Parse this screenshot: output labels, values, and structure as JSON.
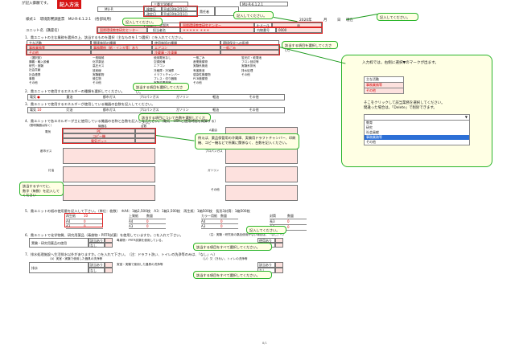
{
  "header": {
    "note_left": "が記入御願です。",
    "badge": "記入方法",
    "org": "三重大学様式",
    "form_code": "MU-R-6.1.2.1",
    "mu_label": "MU-R",
    "request_label": "検査区",
    "request_date": "平成19年2月1日",
    "revision_label": "改定日",
    "revision_date": "平成19年2月1日",
    "admin_label": "責任者",
    "admin_value": "",
    "form_title": "様式１　環境影響調査票　MU-R-6.1.2.1　(各部局用)",
    "year_label": "2020年",
    "month_label": "月",
    "day_label": "日",
    "submit_label": "現在",
    "dept_label": "部局名・学部名",
    "dept_value": "国際環境教育研究センター",
    "email_label": "e-メール",
    "email_value": "@",
    "unit_label": "ユニット名（講座名）",
    "unit_value": "国際環境教育研究センター",
    "person_label": "担当者名",
    "person_value": "＊＊＊＊＊ ＊＊＊",
    "ext_label": "内線番号",
    "ext_value": "0000"
  },
  "callouts": {
    "c1": "記入してください。",
    "c2": "記入してください。",
    "c3": "記入してください。",
    "c4": "該当する項目を選択してください。",
    "c5": "該当する項目を選択してください。",
    "c6": "該当する項目について台数を選択してください。",
    "c7": "例えば、薬品保管用の冷蔵庫、実験用ドラフトチャンバー、印刷機、コピー機などで所属に関係なく、台数を記入ください。",
    "c8": "該当する項目をすべて選択してください。",
    "c9": "該当する項目をすべて選択してください。",
    "c10": "記入してください。",
    "c11": "該当するすべてに、\n数字（毎数）を記入してください"
  },
  "right_panel": {
    "intro": "入力枠では，右側に選択▼のマークが出ます。",
    "mini_items": [
      "主な活動",
      "事務業務等",
      "その他"
    ],
    "mid_text_1": "そこをクリックして該当業務を選択してください。",
    "mid_text_2": "間違った場合は，「Delete」で削除できます。",
    "dropdown_header": "",
    "dropdown_options": [
      "教育",
      "研究",
      "社会貢献",
      "事務業務等",
      "その他"
    ],
    "dropdown_selected": 3
  },
  "section1": {
    "title": "1．貴ユニットの主な業務を選択の上、該当するものを選択（主なものを１つ選択）○を入れてください。",
    "col_main": "主な活動",
    "col_related": "関連施設の種類",
    "col_use": "使用施設の種類",
    "col_env": "環境保全への配慮",
    "main_value": "事務業務等",
    "related_value": "事務関係（紙・インキ等）あり",
    "use_value": "エアコン",
    "env_value": "一般ごみ",
    "main_value2": "その他",
    "use_value2": "冷蔵庫・冷凍庫",
    "select_label": "（選択肢）",
    "options_a": [
      "講義・輸入設備",
      "研究・実験",
      "社会貢献",
      "社会連携",
      "事務",
      "その他"
    ],
    "options_b": [
      "一般機械",
      "化学薬品",
      "高圧ガス",
      "放射線",
      "実験動物",
      "微生物",
      "その他"
    ],
    "options_c": [
      "使用電気なし",
      "空調設備",
      "エアコン",
      "冷蔵庫・冷凍庫",
      "ドラフトチャンバー",
      "プレス・切り器機",
      "実験装置機器",
      "その他"
    ],
    "options_d": [
      "一般ごみ",
      "産業廃棄物",
      "実験系廃液",
      "有害廃液",
      "感染性廃棄物",
      "PCB廃棄物",
      "その他"
    ],
    "options_e": [
      "蛍光灯・乾電池",
      "フロン回収等",
      "実験系排気",
      "排水処理",
      "その他"
    ]
  },
  "section2": {
    "title": "2．貴ユニットで使用するエネルギーの種類を選択してください。",
    "items": [
      "電気",
      "重油",
      "都市ガス",
      "プロパンガス",
      "ガソリン",
      "軽油",
      "その他"
    ],
    "value": "●"
  },
  "section3": {
    "title": "3．貴ユニットで使用するエネルギーが使用している機器の台数を記入してください。",
    "items": [
      "電気",
      "灯油",
      "都市ガス",
      "プロパンガス",
      "ガソリン",
      "軽油",
      "その他"
    ],
    "value": "10"
  },
  "section4": {
    "title": "4．貴ユニットで各エネルギーが主に使用している機器の名称と台数を記入してください。（電気・kWhと使用時間を概算する）",
    "sub": "（照明機器は除く）",
    "col_machine": "機器名",
    "col_count": "台数",
    "rows": [
      {
        "label": "電気",
        "machine": "PC",
        "extra": "A重油"
      },
      {
        "label": "",
        "machine": "コピー機",
        "extra": ""
      },
      {
        "label": "",
        "machine": "電気ポット",
        "extra": ""
      },
      {
        "label": "都市ガス",
        "machine": "",
        "extra": "プロパンガス"
      },
      {
        "label": "灯油",
        "machine": "",
        "extra": "ガソリン"
      },
      {
        "label": "軽油",
        "machine": "",
        "extra": "その他"
      }
    ]
  },
  "section5": {
    "title": "5．貴ユニットの紙の使用量を記入して下さい。（単位：枚数）　※A4：1箱2,500枚　A3：1箱1,500枚　再生紙：1箱500枚　長形3封筒：1箱500枚",
    "paper": [
      {
        "name": "再生紙",
        "val": "10"
      },
      {
        "name": "A4",
        "val": "0"
      },
      {
        "name": "A3",
        "val": "0"
      }
    ],
    "upper": [
      {
        "name": "上質紙",
        "val": "数量"
      },
      {
        "name": "A4",
        "val": "0"
      },
      {
        "name": "A3",
        "val": "0"
      }
    ],
    "color": [
      {
        "name": "カラー用紙",
        "val": "数量"
      },
      {
        "name": "A4",
        "val": "0"
      },
      {
        "name": "A3",
        "val": "0"
      }
    ],
    "env": [
      {
        "name": "封筒",
        "val": "数量"
      },
      {
        "name": "長3",
        "val": "0"
      },
      {
        "name": "角2",
        "val": "0"
      }
    ]
  },
  "section6": {
    "title": "6．貴ユニットで化学物質、研究用薬品（毒劇物・PRTR試薬）を使用していますか。○を入れて下さい。",
    "note": "（注：実験・研究用の薬品使用がない場合は、「なし」へ）",
    "row_label": "実験・研究用薬品の使用",
    "opt_yes": "該当あり",
    "opt_no": "なし",
    "detail": "毒劇物・PRTR試薬を使用している。",
    "use_label": "使用あり",
    "nouse_label": "なし"
  },
  "section7": {
    "title": "7．排水処理施設へ生活排水以外がありますか。○を入れて下さい。　（注：ドラフト洗い、トイレの洗浄等のみは、「なし」へ）",
    "sub1": "（A）実室・実験で使用した器具の洗浄等",
    "sub2": "（い）又（きれい、トイレの洗浄等",
    "row_label": "排水",
    "opt_yes": "該当あり",
    "opt_no": "なし",
    "detail": "実室・実験で使用した器具の洗浄等",
    "use_label": "該当あり",
    "nouse_label": "なし"
  },
  "footer": {
    "page": "8/1"
  }
}
